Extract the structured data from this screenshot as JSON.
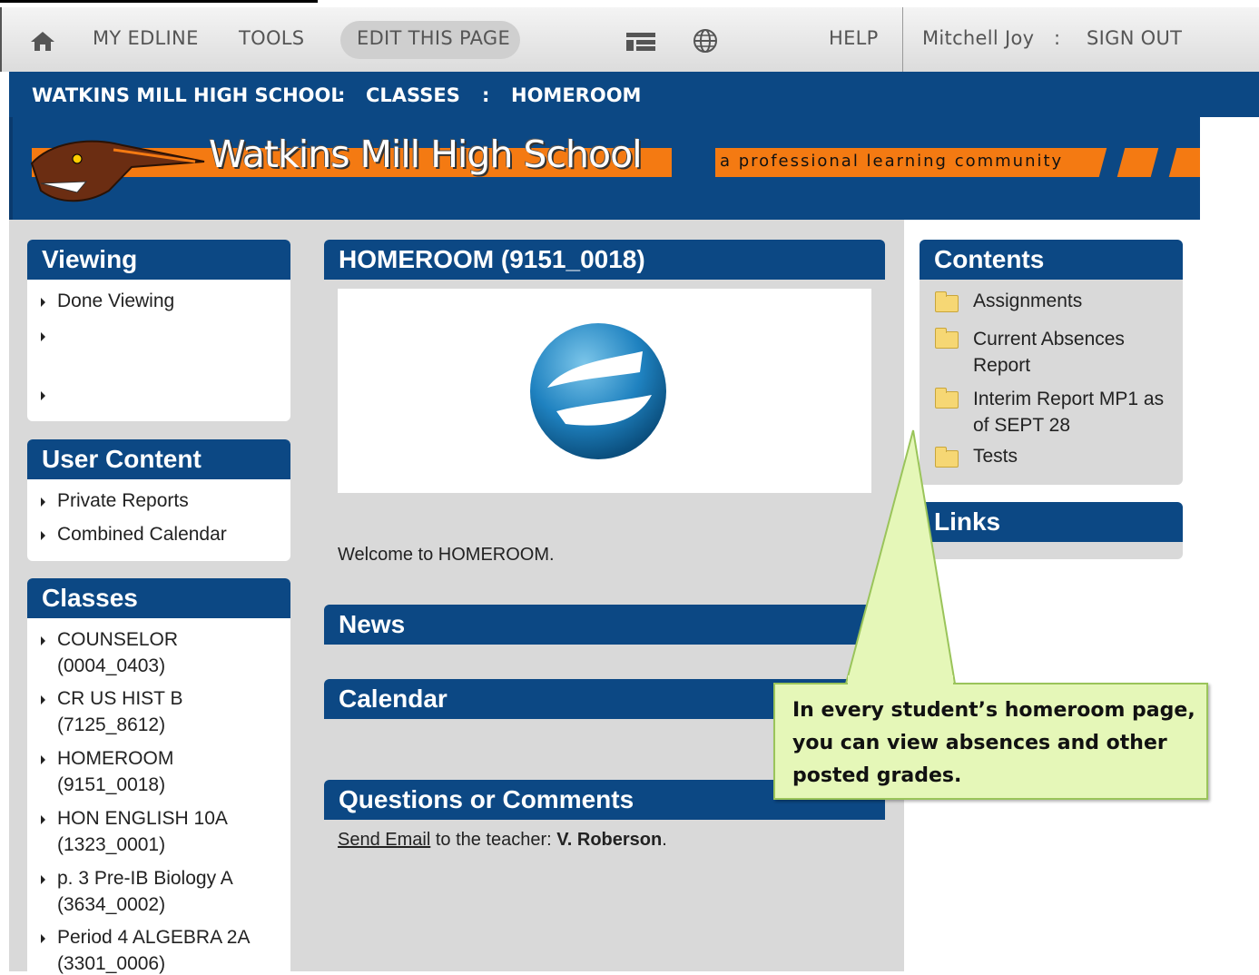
{
  "topnav": {
    "my_edline": "MY EDLINE",
    "tools": "TOOLS",
    "edit_page": "EDIT THIS PAGE",
    "help": "HELP",
    "user_name": "Mitchell Joy",
    "separator": ":",
    "sign_out": "SIGN OUT"
  },
  "breadcrumb": {
    "school": "WATKINS MILL HIGH SCHOOL",
    "sep1": ":",
    "classes": "CLASSES",
    "sep2": ":",
    "homeroom": "HOMEROOM"
  },
  "banner": {
    "title": "Watkins Mill High School",
    "tagline": "a professional learning community"
  },
  "viewing": {
    "title": "Viewing",
    "items": [
      "Done Viewing",
      "",
      ""
    ]
  },
  "user_content": {
    "title": "User Content",
    "items": [
      "Private Reports",
      "Combined Calendar"
    ]
  },
  "classes": {
    "title": "Classes",
    "items": [
      {
        "name": "COUNSELOR",
        "code": "(0004_0403)"
      },
      {
        "name": "CR US HIST B",
        "code": "(7125_8612)"
      },
      {
        "name": "HOMEROOM",
        "code": "(9151_0018)"
      },
      {
        "name": "HON ENGLISH 10A",
        "code": "(1323_0001)"
      },
      {
        "name": "p. 3 Pre-IB Biology A",
        "code": "(3634_0002)"
      },
      {
        "name": "Period 4 ALGEBRA 2A",
        "code": "(3301_0006)"
      }
    ]
  },
  "main": {
    "title": "HOMEROOM (9151_0018)",
    "welcome": "Welcome to HOMEROOM.",
    "news_title": "News",
    "calendar_title": "Calendar",
    "questions_title": "Questions or Comments",
    "send_email": "Send Email",
    "to_teacher": " to the teacher: ",
    "teacher": "V. Roberson",
    "period": "."
  },
  "contents": {
    "title": "Contents",
    "items": [
      "Assignments",
      "Current Absences Report",
      "Interim Report MP1 as of SEPT 28",
      "Tests"
    ]
  },
  "links": {
    "title": "Links"
  },
  "callout": {
    "text": "In every student’s homeroom page, you can view absences and other posted grades."
  },
  "colors": {
    "navy": "#0c4884",
    "orange": "#f47a12",
    "callout_bg": "#e5f7b8"
  }
}
